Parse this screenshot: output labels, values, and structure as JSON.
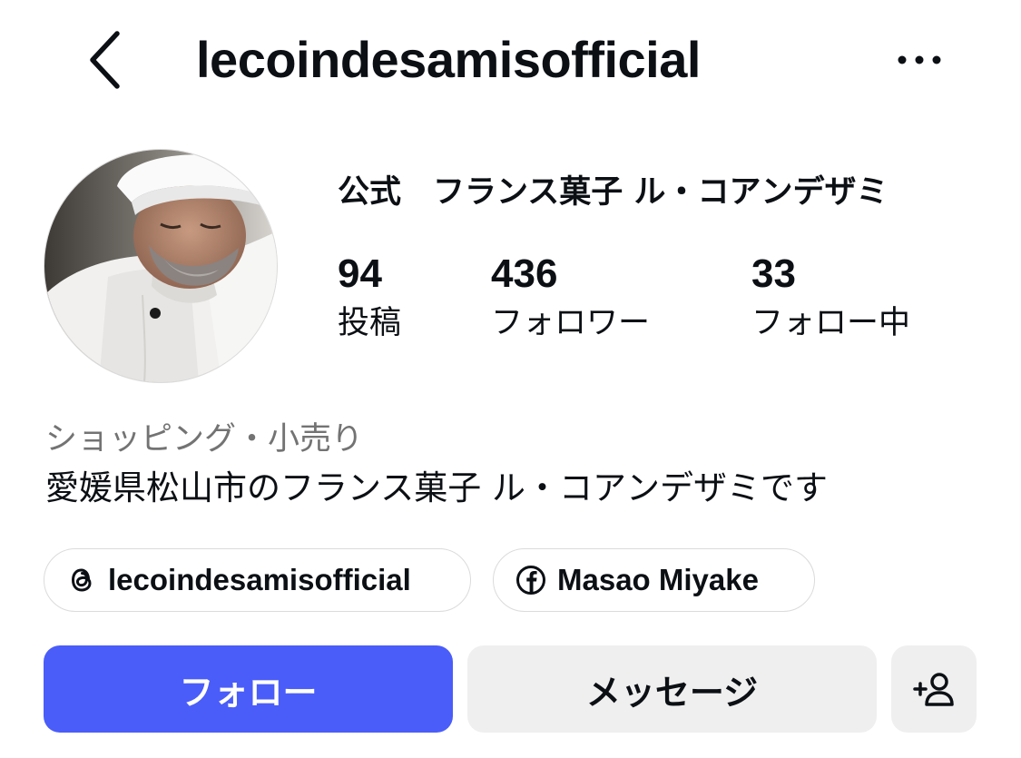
{
  "header": {
    "username": "lecoindesamisofficial",
    "back_icon": "chevron-left-icon",
    "more_icon": "more-horizontal-icon"
  },
  "profile": {
    "display_name": "公式　フランス菓子 ル・コアンデザミ",
    "avatar_icon": "profile-photo"
  },
  "stats": {
    "posts": {
      "count": "94",
      "label": "投稿"
    },
    "followers": {
      "count": "436",
      "label": "フォロワー"
    },
    "following": {
      "count": "33",
      "label": "フォロー中"
    }
  },
  "bio": {
    "category": "ショッピング・小売り",
    "text": "愛媛県松山市のフランス菓子 ル・コアンデザミです"
  },
  "links": [
    {
      "icon": "threads-icon",
      "label": "lecoindesamisofficial"
    },
    {
      "icon": "facebook-icon",
      "label": "Masao  Miyake"
    }
  ],
  "actions": {
    "follow_label": "フォロー",
    "message_label": "メッセージ",
    "suggest_icon": "add-person-icon"
  },
  "colors": {
    "follow_button": "#4a5df9",
    "secondary_button": "#efefef",
    "muted_text": "#737373",
    "text": "#0c1014"
  }
}
